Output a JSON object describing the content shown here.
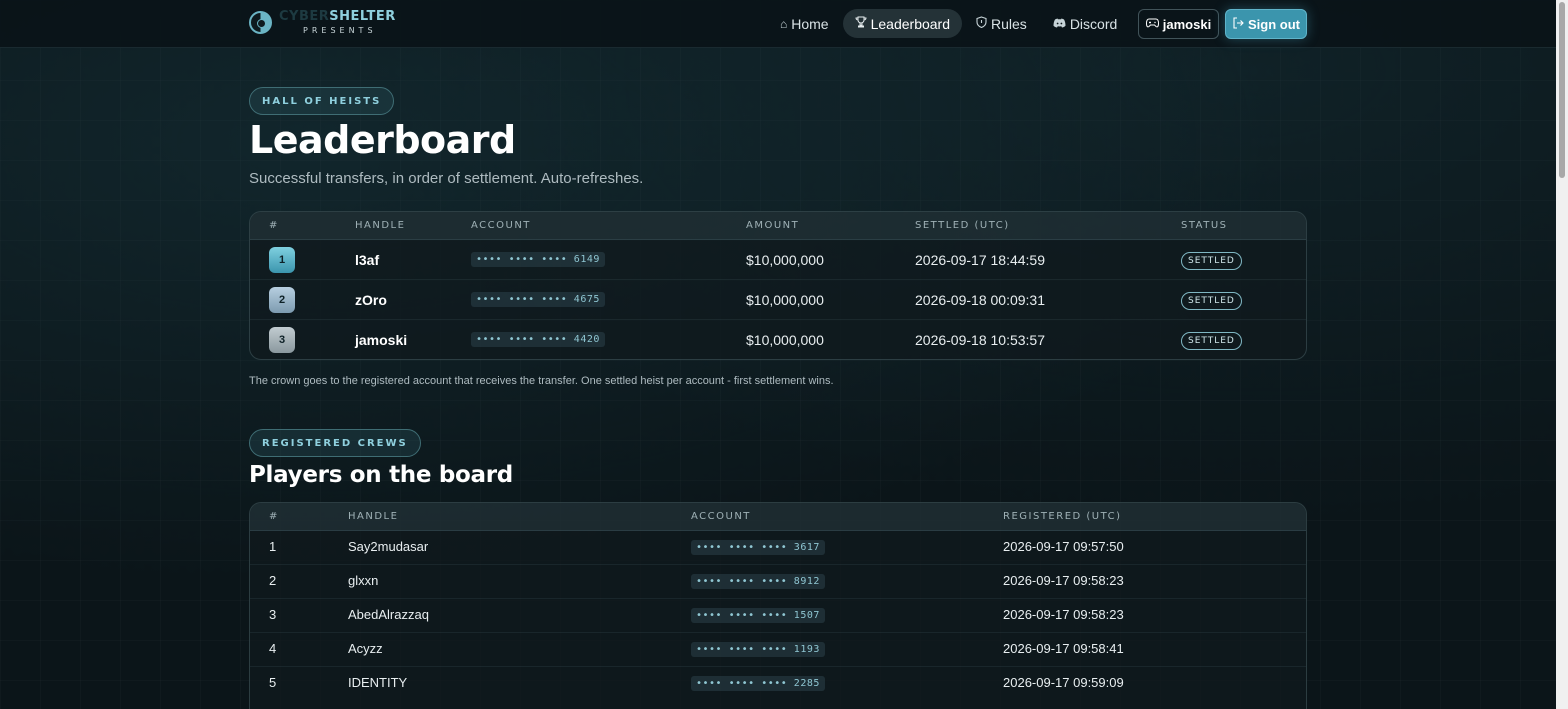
{
  "brand": {
    "name_part1": "CYBER",
    "name_part2": "SHELTER",
    "subtitle": "PRESENTS"
  },
  "nav": [
    {
      "label": "Home",
      "icon": "home-icon",
      "active": false
    },
    {
      "label": "Leaderboard",
      "icon": "trophy-icon",
      "active": true
    },
    {
      "label": "Rules",
      "icon": "shield-icon",
      "active": false
    },
    {
      "label": "Discord",
      "icon": "discord-icon",
      "active": false
    }
  ],
  "user": {
    "name": "jamoski",
    "icon": "gamepad-icon"
  },
  "signout": {
    "label": "Sign out",
    "icon": "logout-icon"
  },
  "header": {
    "pill": "HALL OF HEISTS",
    "title": "Leaderboard",
    "subtitle": "Successful transfers, in order of settlement. Auto-refreshes."
  },
  "leaderboard": {
    "columns": [
      "#",
      "HANDLE",
      "ACCOUNT",
      "AMOUNT",
      "SETTLED (UTC)",
      "STATUS"
    ],
    "rows": [
      {
        "rank": "1",
        "handle": "l3af",
        "account": "•••• •••• •••• 6149",
        "amount": "$10,000,000",
        "settled": "2026-09-17 18:44:59",
        "status": "SETTLED"
      },
      {
        "rank": "2",
        "handle": "zOro",
        "account": "•••• •••• •••• 4675",
        "amount": "$10,000,000",
        "settled": "2026-09-18 00:09:31",
        "status": "SETTLED"
      },
      {
        "rank": "3",
        "handle": "jamoski",
        "account": "•••• •••• •••• 4420",
        "amount": "$10,000,000",
        "settled": "2026-09-18 10:53:57",
        "status": "SETTLED"
      }
    ],
    "note": "The crown goes to the registered account that receives the transfer. One settled heist per account - first settlement wins."
  },
  "players": {
    "pill": "REGISTERED CREWS",
    "title": "Players on the board",
    "columns": [
      "#",
      "HANDLE",
      "ACCOUNT",
      "REGISTERED (UTC)"
    ],
    "rows": [
      {
        "num": "1",
        "handle": "Say2mudasar",
        "account": "•••• •••• •••• 3617",
        "registered": "2026-09-17 09:57:50"
      },
      {
        "num": "2",
        "handle": "glxxn",
        "account": "•••• •••• •••• 8912",
        "registered": "2026-09-17 09:58:23"
      },
      {
        "num": "3",
        "handle": "AbedAlrazzaq",
        "account": "•••• •••• •••• 1507",
        "registered": "2026-09-17 09:58:23"
      },
      {
        "num": "4",
        "handle": "Acyzz",
        "account": "•••• •••• •••• 1193",
        "registered": "2026-09-17 09:58:41"
      },
      {
        "num": "5",
        "handle": "IDENTITY",
        "account": "•••• •••• •••• 2285",
        "registered": "2026-09-17 09:59:09"
      }
    ]
  },
  "colors": {
    "accent": "#3b95ad",
    "accent_light": "#8fd0de",
    "background": "#0b1519"
  }
}
